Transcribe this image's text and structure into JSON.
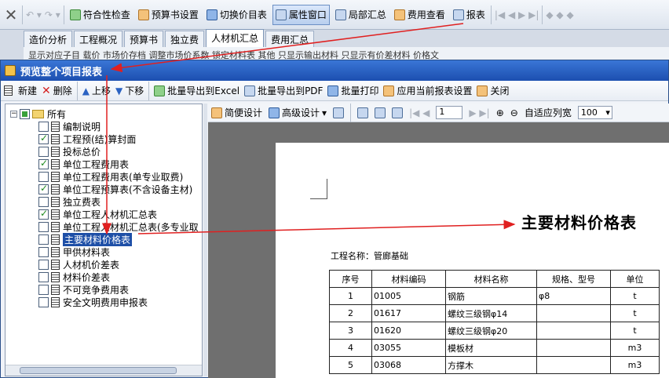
{
  "app_toolbar": {
    "items": [
      {
        "label": "符合性检查",
        "icon": "check-icon"
      },
      {
        "label": "预算书设置",
        "icon": "settings-icon"
      },
      {
        "label": "切换价目表",
        "icon": "switch-icon"
      },
      {
        "label": "属性窗口",
        "icon": "window-icon",
        "active": true
      },
      {
        "label": "局部汇总",
        "icon": "sum-icon"
      },
      {
        "label": "费用查看",
        "icon": "view-icon"
      },
      {
        "label": "报表",
        "icon": "report-icon"
      }
    ]
  },
  "tabs": [
    "造价分析",
    "工程概况",
    "预算书",
    "独立费",
    "人材机汇总",
    "费用汇总"
  ],
  "active_tab": "人材机汇总",
  "sub_toolbar_text": "显示对应子目  载价  市场价存档  调整市场价系数  锁定材料表  其他  只显示输出材料  只显示有价差材料  价格文",
  "dialog": {
    "title": "预览整个项目报表",
    "toolbar": {
      "new": "新建",
      "delete": "删除",
      "move_up": "上移",
      "move_down": "下移",
      "export_excel": "批量导出到Excel",
      "export_pdf": "批量导出到PDF",
      "batch_print": "批量打印",
      "apply_settings": "应用当前报表设置",
      "close": "关闭"
    },
    "tree": {
      "root": "所有",
      "items": [
        {
          "label": "编制说明",
          "checked": false
        },
        {
          "label": "工程预(结)算封面",
          "checked": true
        },
        {
          "label": "投标总价",
          "checked": false
        },
        {
          "label": "单位工程费用表",
          "checked": true
        },
        {
          "label": "单位工程费用表(单专业取费)",
          "checked": false
        },
        {
          "label": "单位工程预算表(不含设备主材)",
          "checked": true
        },
        {
          "label": "独立费表",
          "checked": false
        },
        {
          "label": "单位工程人材机汇总表",
          "checked": true
        },
        {
          "label": "单位工程人材机汇总表(多专业取",
          "checked": false
        },
        {
          "label": "主要材料价格表",
          "checked": false,
          "selected": true
        },
        {
          "label": "甲供材料表",
          "checked": false
        },
        {
          "label": "人材机价差表",
          "checked": false
        },
        {
          "label": "材料价差表",
          "checked": false
        },
        {
          "label": "不可竞争费用表",
          "checked": false
        },
        {
          "label": "安全文明费用申报表",
          "checked": false
        }
      ]
    },
    "preview_toolbar": {
      "simple_design": "简便设计",
      "advanced_design": "高级设计",
      "page": "1",
      "fit_width": "自适应列宽",
      "zoom": "100"
    },
    "report": {
      "title": "主要材料价格表",
      "project_label": "工程名称：",
      "project_name": "管廊基础",
      "headers": [
        "序号",
        "材料编码",
        "材料名称",
        "规格、型号",
        "单位"
      ],
      "rows": [
        [
          "1",
          "01005",
          "钢筋",
          "φ8",
          "t"
        ],
        [
          "2",
          "01617",
          "螺纹三级钢φ14",
          "",
          "t"
        ],
        [
          "3",
          "01620",
          "螺纹三级钢φ20",
          "",
          "t"
        ],
        [
          "4",
          "03055",
          "模板材",
          "",
          "m3"
        ],
        [
          "5",
          "03068",
          "方撑木",
          "",
          "m3"
        ]
      ]
    }
  },
  "colors": {
    "title_bar": "#1c4fb0",
    "selected": "#1e4fa7",
    "arrow": "#e02020",
    "preview_bg": "#6f6f6f"
  }
}
